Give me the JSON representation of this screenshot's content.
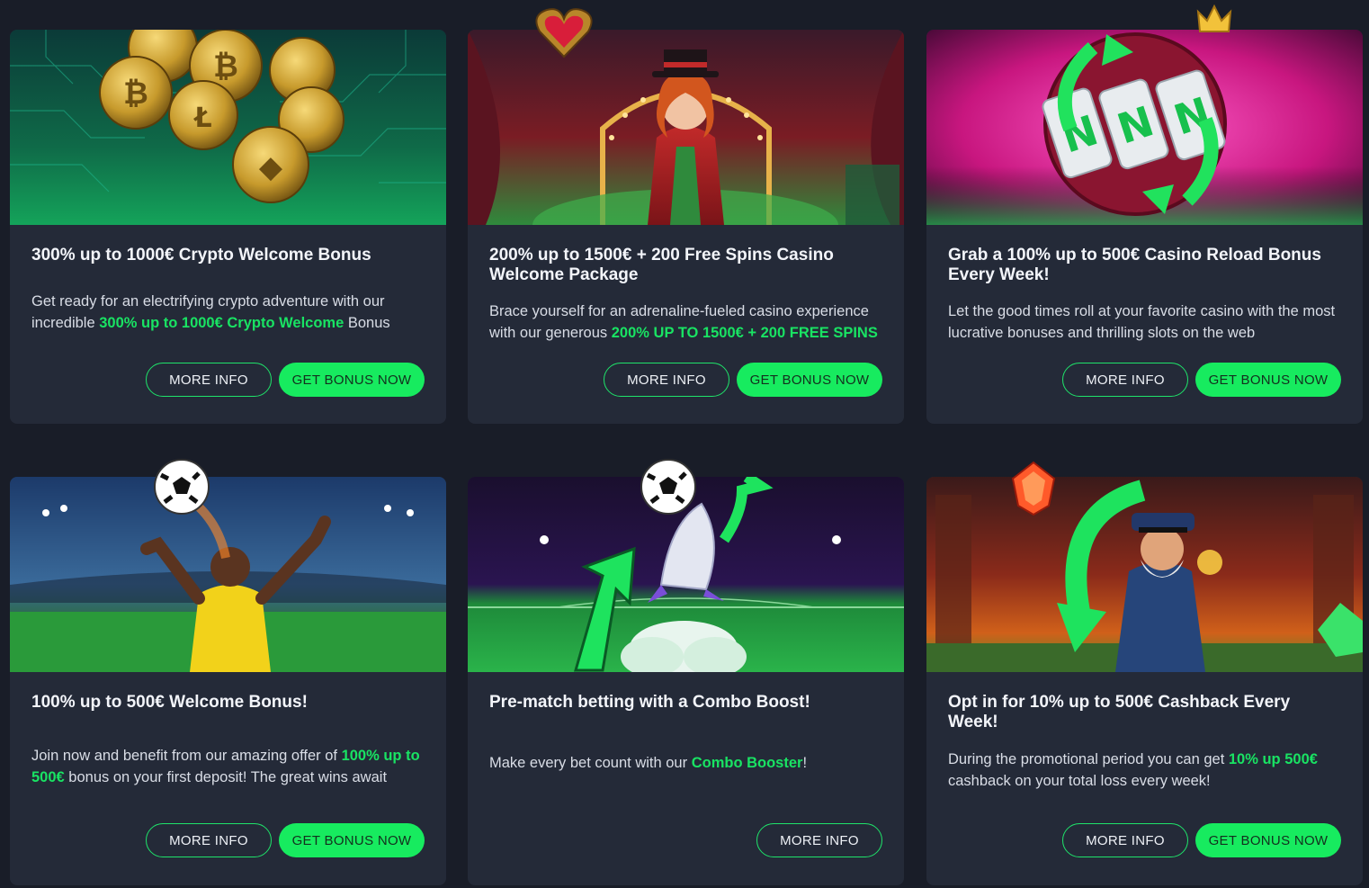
{
  "colors": {
    "page_bg": "#191d28",
    "card_bg": "#242a38",
    "accent": "#17eb5f",
    "highlight_text": "#19e363"
  },
  "cards": [
    {
      "title": "300% up to 1000€ Crypto Welcome Bonus",
      "desc_pre": "Get ready for an electrifying crypto adventure with our incredible ",
      "desc_hl": "300% up to 1000€ Crypto Welcome",
      "desc_post": " Bonus",
      "more_info": "MORE INFO",
      "get_bonus": "GET BONUS NOW",
      "banner_icon": "crypto-coins"
    },
    {
      "title": "200% up to 1500€ + 200 Free Spins Casino Welcome Package",
      "desc_pre": "Brace yourself for an adrenaline-fueled casino experience with our generous ",
      "desc_hl": "200% UP TO 1500€ + 200 FREE SPINS",
      "desc_post": "",
      "more_info": "MORE INFO",
      "get_bonus": "GET BONUS NOW",
      "banner_icon": "circus-ringmaster"
    },
    {
      "title": "Grab a 100% up to 500€ Casino Reload Bonus Every Week!",
      "desc_pre": "Let the good times roll at your favorite casino with the most lucrative bonuses and thrilling slots on the web",
      "desc_hl": "",
      "desc_post": "",
      "more_info": "MORE INFO",
      "get_bonus": "GET BONUS NOW",
      "banner_icon": "slot-reels"
    },
    {
      "title": "100% up to 500€ Welcome Bonus!",
      "desc_pre": "Join now and benefit from our amazing offer of ",
      "desc_hl": "100% up to 500€",
      "desc_post": " bonus on your first deposit! The great wins await",
      "more_info": "MORE INFO",
      "get_bonus": "GET BONUS NOW",
      "banner_icon": "football-player"
    },
    {
      "title": "Pre-match betting with a Combo Boost!",
      "desc_pre": "Make every bet count with our ",
      "desc_hl": "Combo Booster",
      "desc_post": "!",
      "more_info": "MORE INFO",
      "banner_icon": "football-rocket"
    },
    {
      "title": "Opt in for 10% up to 500€ Cashback Every Week!",
      "desc_pre": "During the promotional period you can get ",
      "desc_hl": "10% up 500€",
      "desc_post": " cashback on your total loss every week!",
      "more_info": "MORE INFO",
      "get_bonus": "GET BONUS NOW",
      "banner_icon": "captain-cashback"
    }
  ]
}
